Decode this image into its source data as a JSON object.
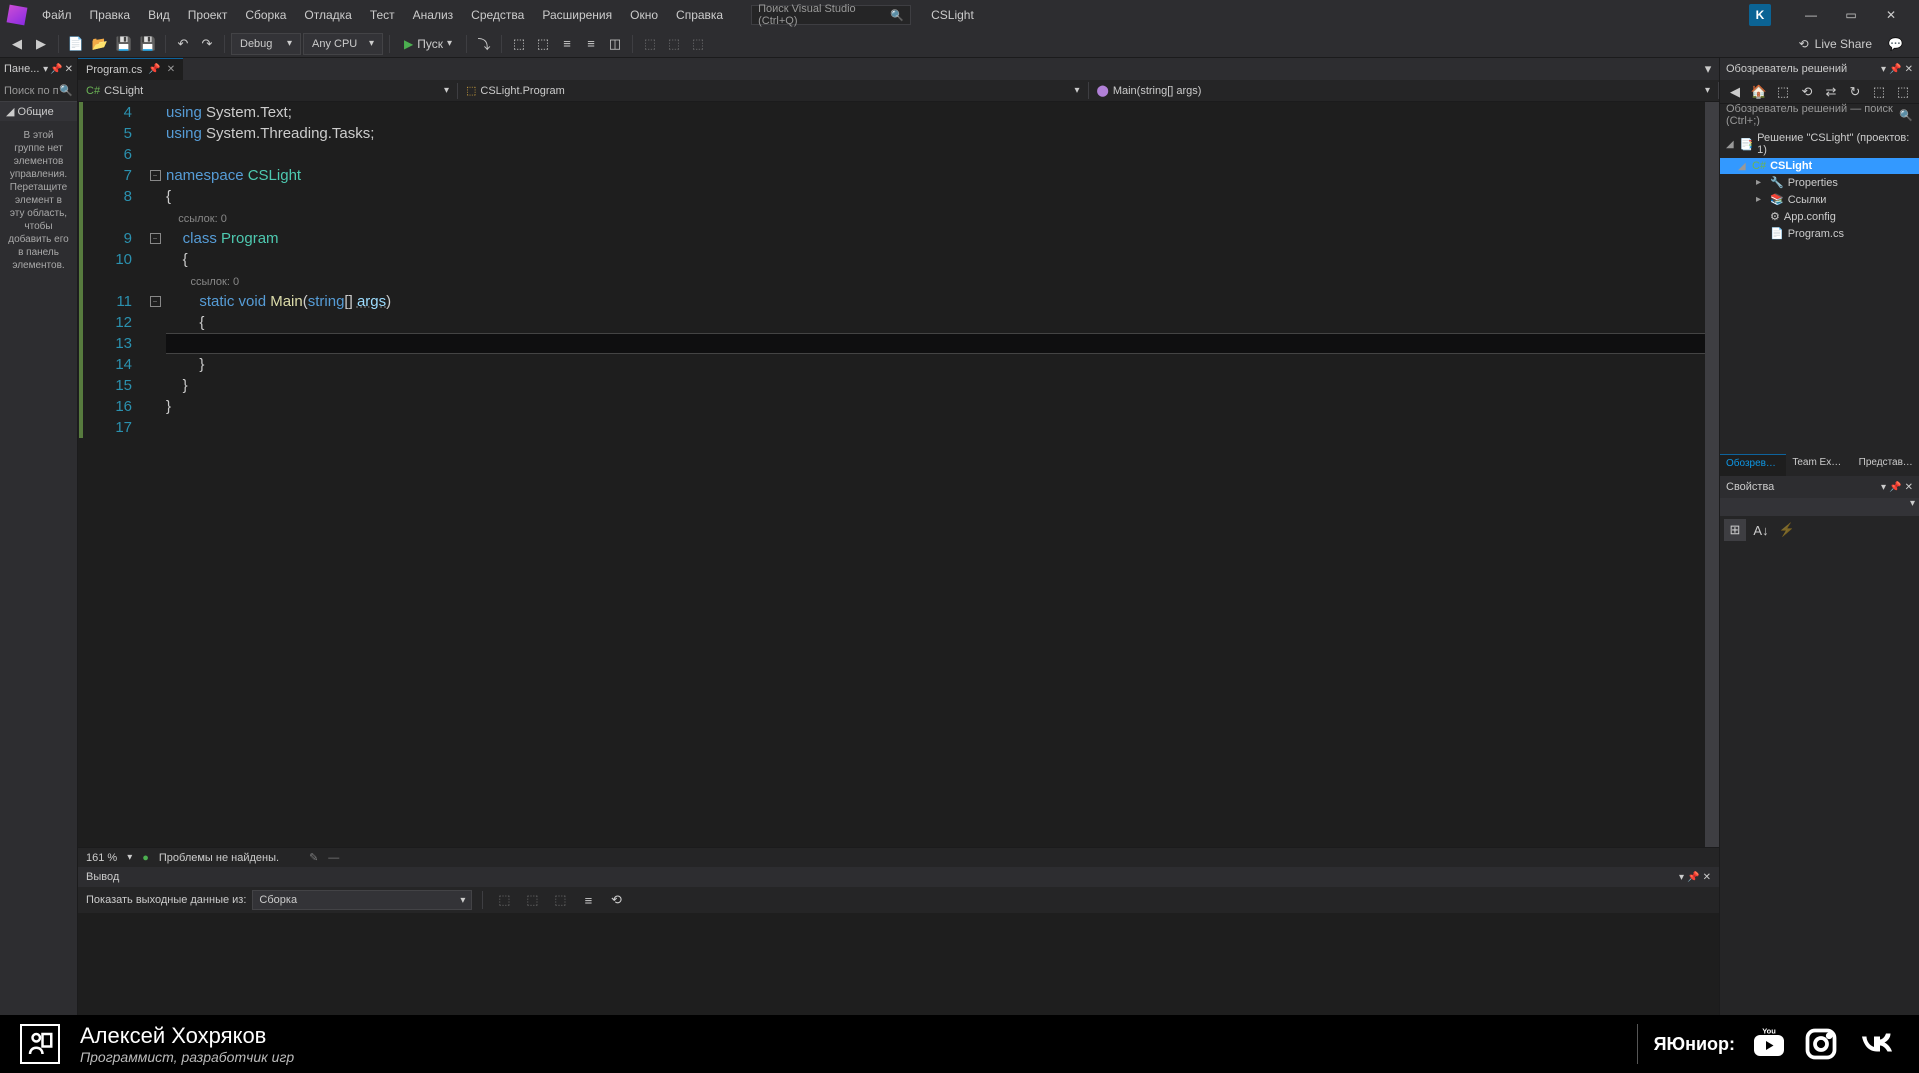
{
  "menu": [
    "Файл",
    "Правка",
    "Вид",
    "Проект",
    "Сборка",
    "Отладка",
    "Тест",
    "Анализ",
    "Средства",
    "Расширения",
    "Окно",
    "Справка"
  ],
  "searchPlaceholder": "Поиск Visual Studio (Ctrl+Q)",
  "projectName": "CSLight",
  "userInitial": "K",
  "toolbar": {
    "config": "Debug",
    "platform": "Any CPU",
    "start": "Пуск",
    "liveShare": "Live Share"
  },
  "toolbox": {
    "title": "Пане...",
    "searchPlaceholder": "Поиск по п",
    "group": "Общие",
    "message": "В этой группе нет элементов управления. Перетащите элемент в эту область, чтобы добавить его в панель элементов."
  },
  "tab": "Program.cs",
  "nav": {
    "project": "CSLight",
    "class": "CSLight.Program",
    "method": "Main(string[] args)"
  },
  "code": {
    "lines": [
      {
        "n": 4,
        "seg": [
          {
            "t": "using ",
            "c": "kw"
          },
          {
            "t": "System.Text;",
            "c": "punct"
          }
        ]
      },
      {
        "n": 5,
        "seg": [
          {
            "t": "using ",
            "c": "kw"
          },
          {
            "t": "System.Threading.Tasks;",
            "c": "punct"
          }
        ]
      },
      {
        "n": 6,
        "seg": []
      },
      {
        "n": 7,
        "fold": true,
        "seg": [
          {
            "t": "namespace ",
            "c": "kw"
          },
          {
            "t": "CSLight",
            "c": "type"
          }
        ]
      },
      {
        "n": 8,
        "seg": [
          {
            "t": "{",
            "c": "punct"
          }
        ]
      },
      {
        "n": 0,
        "ref": "ссылок: 0",
        "indent": "    "
      },
      {
        "n": 9,
        "fold": true,
        "seg": [
          {
            "t": "    ",
            "c": ""
          },
          {
            "t": "class ",
            "c": "kw"
          },
          {
            "t": "Program",
            "c": "type"
          }
        ]
      },
      {
        "n": 10,
        "seg": [
          {
            "t": "    {",
            "c": "punct"
          }
        ]
      },
      {
        "n": 0,
        "ref": "ссылок: 0",
        "indent": "        "
      },
      {
        "n": 11,
        "fold": true,
        "seg": [
          {
            "t": "        ",
            "c": ""
          },
          {
            "t": "static void ",
            "c": "kw"
          },
          {
            "t": "Main",
            "c": "ident"
          },
          {
            "t": "(",
            "c": "punct"
          },
          {
            "t": "string",
            "c": "kw"
          },
          {
            "t": "[] ",
            "c": "punct"
          },
          {
            "t": "args",
            "c": "param"
          },
          {
            "t": ")",
            "c": "punct"
          }
        ]
      },
      {
        "n": 12,
        "seg": [
          {
            "t": "        {",
            "c": "punct"
          }
        ]
      },
      {
        "n": 13,
        "hl": true,
        "seg": [
          {
            "t": "",
            "c": ""
          }
        ]
      },
      {
        "n": 14,
        "seg": [
          {
            "t": "        }",
            "c": "punct"
          }
        ]
      },
      {
        "n": 15,
        "seg": [
          {
            "t": "    }",
            "c": "punct"
          }
        ]
      },
      {
        "n": 16,
        "seg": [
          {
            "t": "}",
            "c": "punct"
          }
        ]
      },
      {
        "n": 17,
        "seg": []
      }
    ]
  },
  "status": {
    "zoom": "161 %",
    "problems": "Проблемы не найдены."
  },
  "output": {
    "title": "Вывод",
    "showFrom": "Показать выходные данные из:",
    "source": "Сборка"
  },
  "solutionExplorer": {
    "title": "Обозреватель решений",
    "searchPlaceholder": "Обозреватель решений — поиск (Ctrl+;)",
    "root": "Решение \"CSLight\" (проектов: 1)",
    "project": "CSLight",
    "items": [
      "Properties",
      "Ссылки",
      "App.config",
      "Program.cs"
    ]
  },
  "rightTabs": [
    "Обозревате...",
    "Team Explor...",
    "Представле..."
  ],
  "properties": {
    "title": "Свойства"
  },
  "footer": {
    "name": "Алексей Хохряков",
    "role": "Программист, разработчик игр",
    "brand": "ЯЮниор:"
  }
}
